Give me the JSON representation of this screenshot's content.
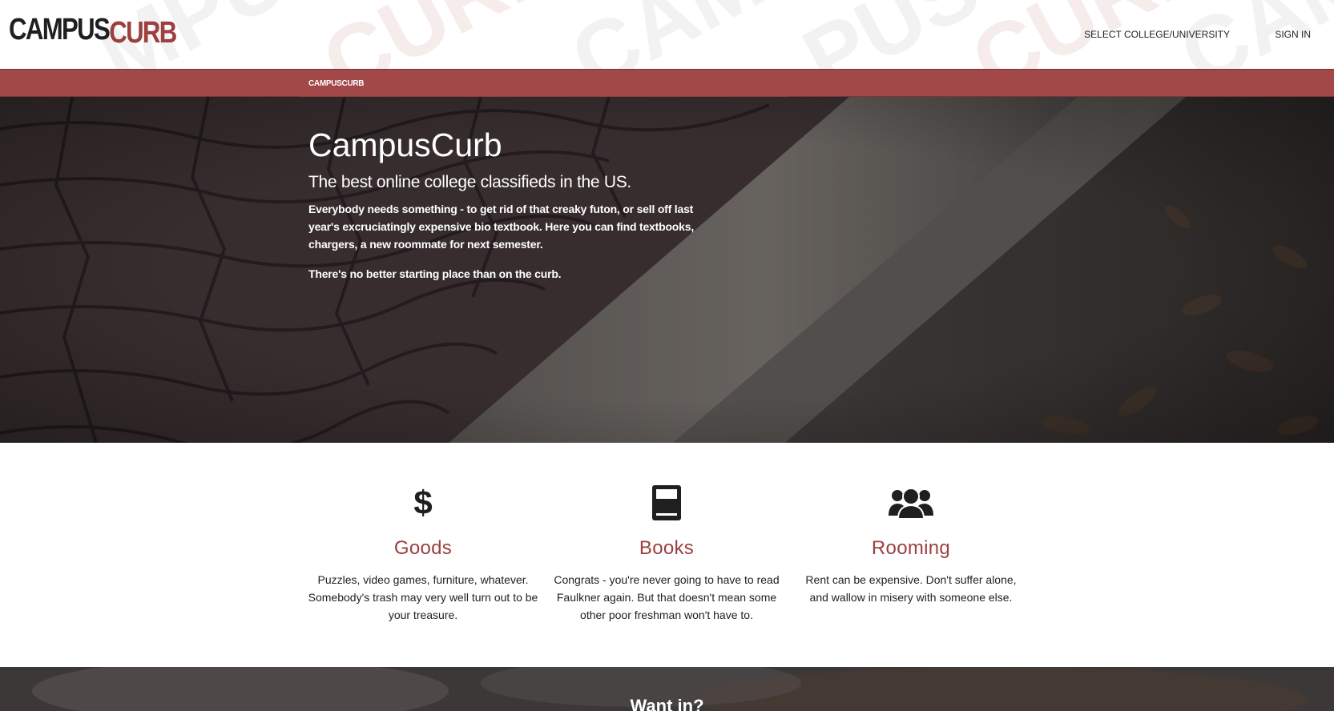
{
  "header": {
    "logo_part1": "CAMPUS",
    "logo_part2": "CURB",
    "nav": {
      "select_college": "SELECT COLLEGE/UNIVERSITY",
      "sign_in": "SIGN IN"
    }
  },
  "breadcrumb": {
    "current": "CAMPUSCURB"
  },
  "hero": {
    "title": "CampusCurb",
    "subtitle": "The best online college classifieds in the US.",
    "body": "Everybody needs something - to get rid of that creaky futon, or sell off last year's excruciatingly expensive bio textbook. Here you can find textbooks, chargers, a new roommate for next semester.",
    "tagline": "There's no better starting place than on the curb."
  },
  "features": [
    {
      "icon": "dollar-icon",
      "glyph": "$",
      "title": "Goods",
      "text": "Puzzles, video games, furniture, whatever. Somebody's trash may very well turn out to be your treasure."
    },
    {
      "icon": "book-icon",
      "title": "Books",
      "text": "Congrats - you're never going to have to read Faulkner again. But that doesn't mean some other poor freshman won't have to."
    },
    {
      "icon": "users-icon",
      "title": "Rooming",
      "text": "Rent can be expensive. Don't suffer alone, and wallow in misery with someone else."
    }
  ],
  "cta": {
    "title": "Want in?"
  },
  "colors": {
    "brand": "#9c3f3f",
    "breadcrumb_bar": "#a34848",
    "dark_text": "#1f1f1f"
  }
}
